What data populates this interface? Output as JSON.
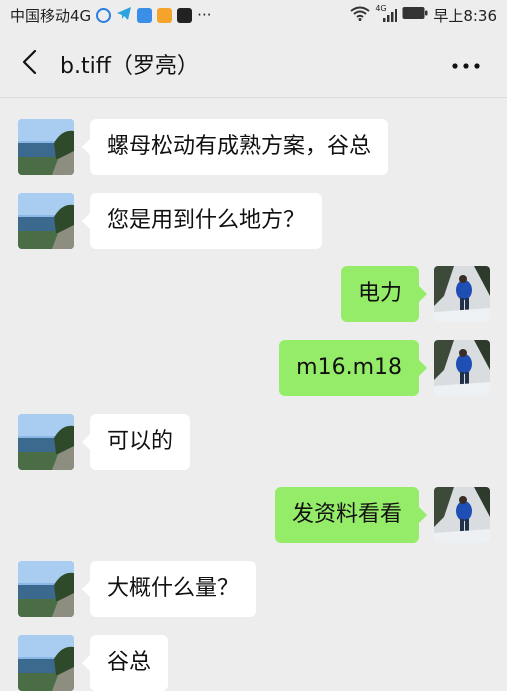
{
  "status_bar": {
    "carrier": "中国移动4G",
    "more": "···",
    "network": "4G",
    "time": "早上8:36"
  },
  "header": {
    "title": "b.tiff（罗亮）"
  },
  "messages": [
    {
      "side": "in",
      "text": "螺母松动有成熟方案，谷总"
    },
    {
      "side": "in",
      "text": "您是用到什么地方？"
    },
    {
      "side": "out",
      "text": "电力"
    },
    {
      "side": "out",
      "text": "m16.m18"
    },
    {
      "side": "in",
      "text": "可以的"
    },
    {
      "side": "out",
      "text": "发资料看看"
    },
    {
      "side": "in",
      "text": "大概什么量？"
    },
    {
      "side": "in",
      "text": "谷总"
    }
  ],
  "colors": {
    "background": "#ededed",
    "incoming_bubble": "#ffffff",
    "outgoing_bubble": "#95ec69"
  },
  "icons": {
    "back": "chevron-left-icon",
    "more": "more-dots-icon",
    "wifi": "wifi-icon",
    "signal": "signal-icon",
    "battery": "battery-icon"
  }
}
